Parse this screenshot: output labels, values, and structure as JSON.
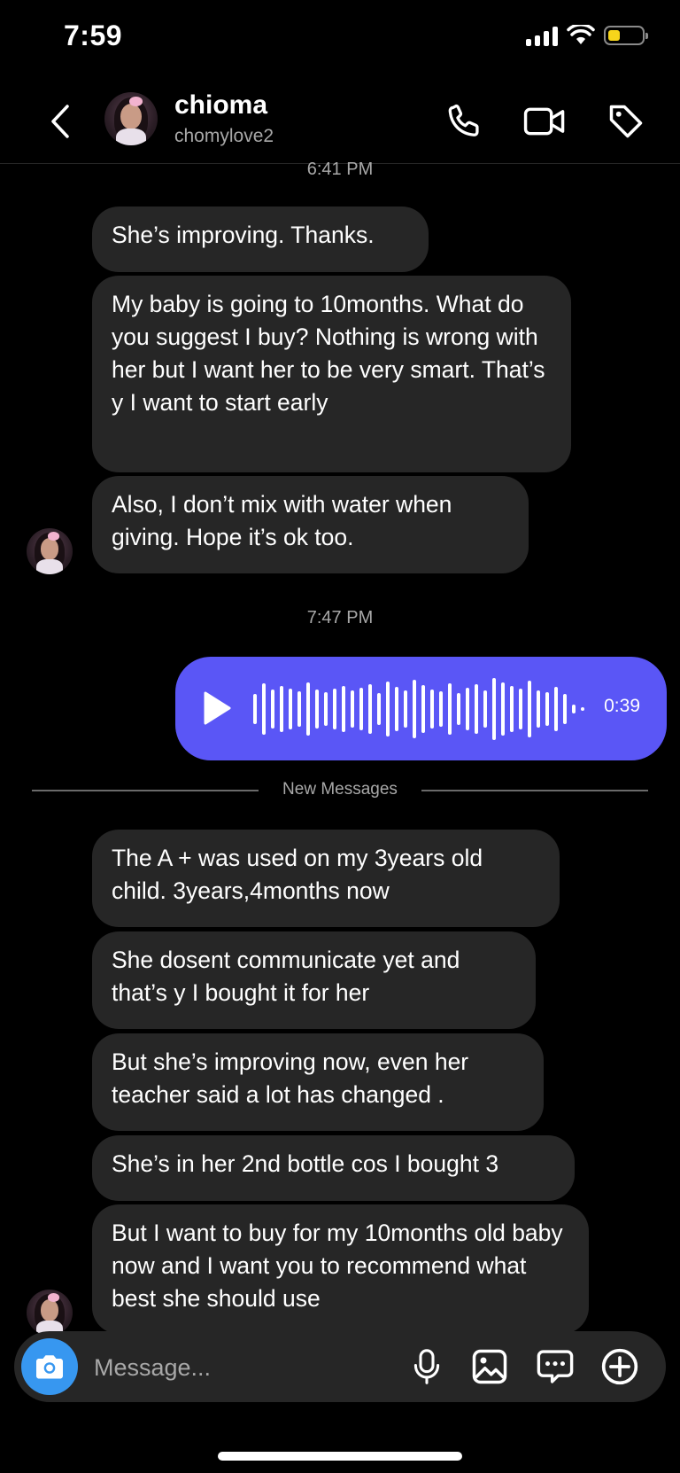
{
  "status_bar": {
    "time": "7:59",
    "battery_level": 0.35,
    "battery_color": "#f7d51b"
  },
  "header": {
    "back_icon": "chevron-left-icon",
    "name": "chioma",
    "username": "chomylove2",
    "actions": [
      "phone-icon",
      "video-camera-icon",
      "tag-icon"
    ]
  },
  "conversation": {
    "timestamp_top": "6:41 PM",
    "earlier_messages": [
      "She’s improving. Thanks.",
      "My baby is going to 10months. What do you suggest I buy? Nothing is wrong with her but I want her to be very smart. That’s y I want to start early",
      "Also, I don’t mix with water when giving. Hope it’s ok too."
    ],
    "timestamp_mid": "7:47 PM",
    "voice_message": {
      "duration": "0:39",
      "color": "#5a56f6"
    },
    "new_messages_label": "New Messages",
    "new_messages": [
      "The A + was used on my 3years old child. 3years,4months now",
      "She dosent communicate yet and that’s y I bought it for her",
      "But she’s improving now, even her teacher said a lot has changed .",
      "She’s in her 2nd bottle cos I bought 3",
      "But I want to buy for my 10months old baby now and I want you to recommend what best she should use"
    ]
  },
  "composer": {
    "placeholder": "Message...",
    "icons": [
      "camera-icon",
      "microphone-icon",
      "image-icon",
      "sticker-icon",
      "plus-icon"
    ]
  }
}
